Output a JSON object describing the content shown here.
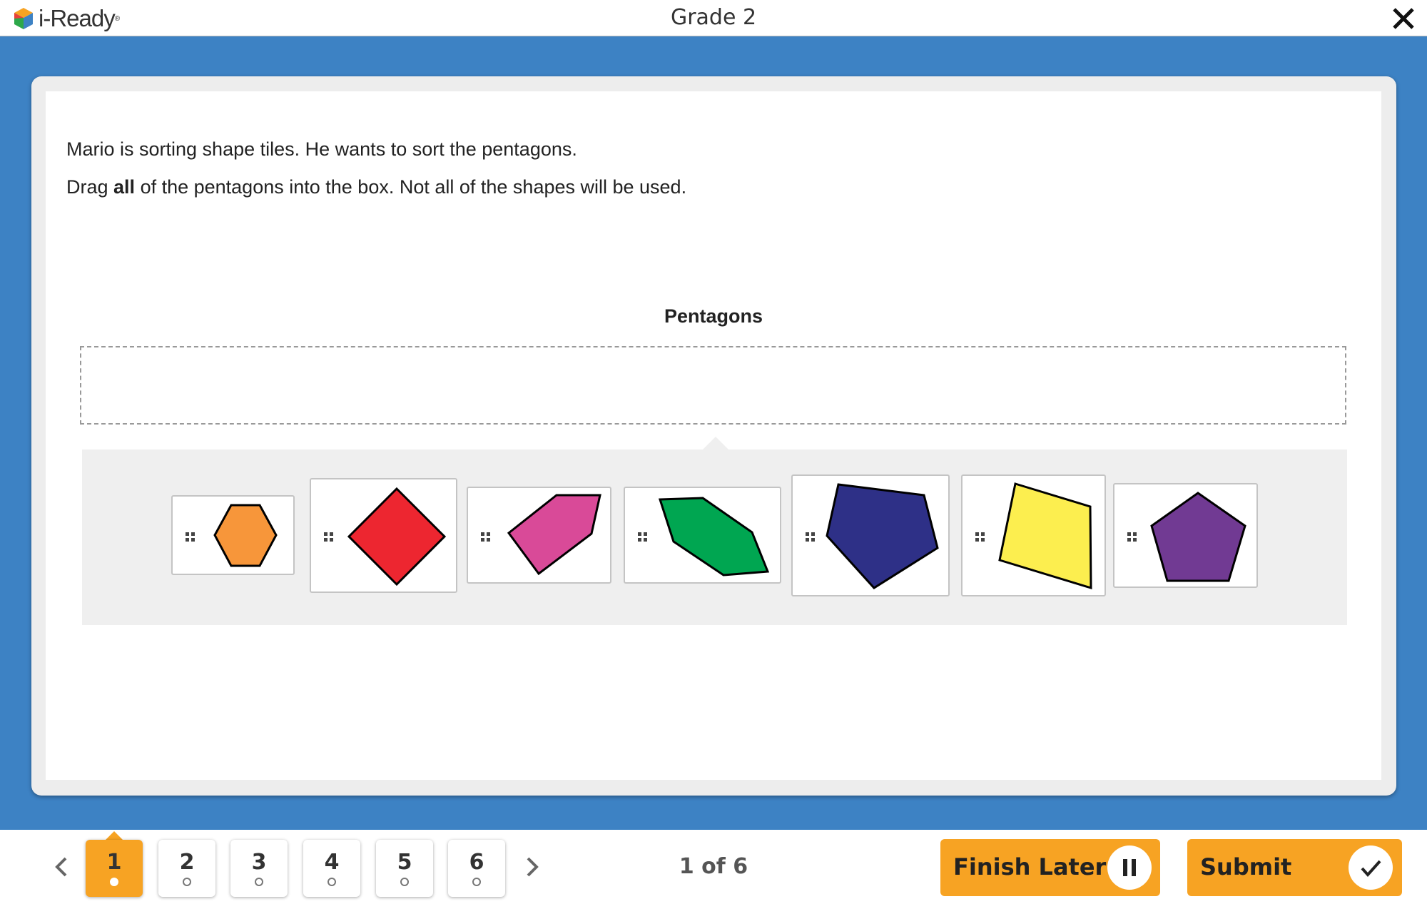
{
  "app": {
    "logo_text": "i-Ready",
    "title": "Grade 2",
    "close_icon": "close-icon"
  },
  "question": {
    "line1": "Mario is sorting shape tiles. He wants to sort the pentagons.",
    "line2_pre": "Drag ",
    "line2_bold": "all",
    "line2_post": " of the pentagons into the box. Not all of the shapes will be used.",
    "bin_label": "Pentagons"
  },
  "tiles": [
    {
      "shape": "hexagon",
      "color": "#f7963a"
    },
    {
      "shape": "square-rotated",
      "color": "#ed2630"
    },
    {
      "shape": "pentagon",
      "color": "#d94a98"
    },
    {
      "shape": "hexagon-irregular",
      "color": "#00a651"
    },
    {
      "shape": "pentagon",
      "color": "#2e3087"
    },
    {
      "shape": "quadrilateral",
      "color": "#fcee4f"
    },
    {
      "shape": "pentagon",
      "color": "#713a93"
    }
  ],
  "footer": {
    "questions": [
      "1",
      "2",
      "3",
      "4",
      "5",
      "6"
    ],
    "active_question": "1",
    "progress": "1 of 6",
    "finish_later": "Finish Later",
    "submit": "Submit",
    "prev_icon": "chevron-left-icon",
    "next_icon": "chevron-right-icon",
    "pause_icon": "pause-icon",
    "check_icon": "check-icon"
  },
  "colors": {
    "background": "#3d82c4",
    "accent": "#f7a323"
  }
}
